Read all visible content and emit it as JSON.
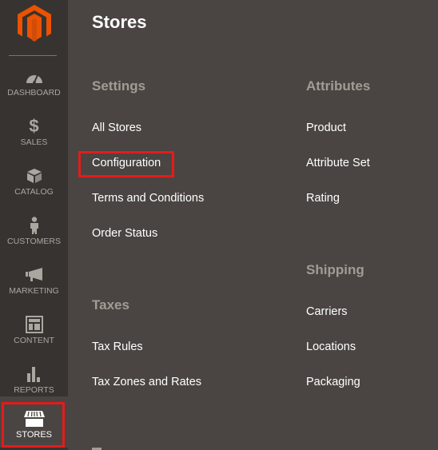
{
  "sidebar": {
    "logo": "magento-logo",
    "items": [
      {
        "label": "Dashboard",
        "icon": "dashboard-gauge-icon"
      },
      {
        "label": "Sales",
        "icon": "dollar-icon"
      },
      {
        "label": "Catalog",
        "icon": "box-icon"
      },
      {
        "label": "Customers",
        "icon": "person-icon"
      },
      {
        "label": "Marketing",
        "icon": "megaphone-icon"
      },
      {
        "label": "Content",
        "icon": "layout-icon"
      },
      {
        "label": "Reports",
        "icon": "bar-chart-icon"
      },
      {
        "label": "Stores",
        "icon": "storefront-icon",
        "active": true
      }
    ]
  },
  "panel": {
    "title": "Stores",
    "sections": {
      "settings": {
        "title": "Settings",
        "links": [
          "All Stores",
          "Configuration",
          "Terms and Conditions",
          "Order Status"
        ]
      },
      "taxes": {
        "title": "Taxes",
        "links": [
          "Tax Rules",
          "Tax Zones and Rates"
        ]
      },
      "attributes": {
        "title": "Attributes",
        "links": [
          "Product",
          "Attribute Set",
          "Rating"
        ]
      },
      "shipping": {
        "title": "Shipping",
        "links": [
          "Carriers",
          "Locations",
          "Packaging"
        ]
      }
    }
  },
  "colors": {
    "accent_logo": "#eb5202",
    "highlight": "#e41b1b",
    "sidebar_bg": "#373330",
    "panel_bg": "#4a4542"
  }
}
